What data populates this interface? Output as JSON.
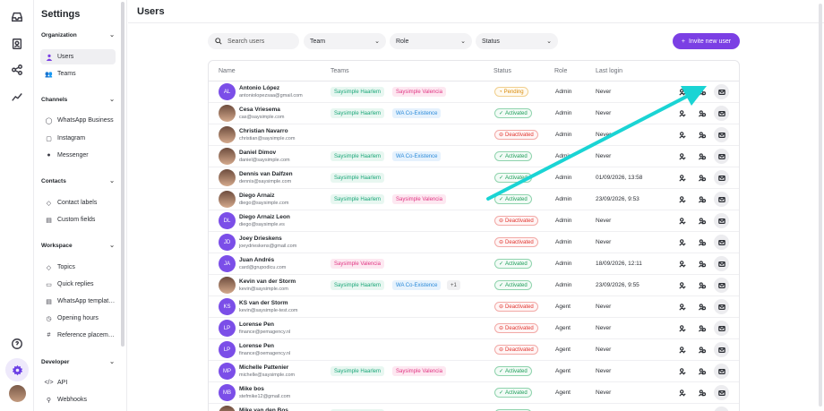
{
  "rail": {
    "icons": [
      "inbox-icon",
      "contacts-icon",
      "flows-icon",
      "reports-icon",
      "help-icon",
      "settings-icon",
      "avatar"
    ]
  },
  "sidebar": {
    "title": "Settings",
    "sections": [
      {
        "label": "Organization",
        "items": [
          {
            "label": "Users",
            "icon": "user-icon",
            "active": true
          },
          {
            "label": "Teams",
            "icon": "teams-icon"
          }
        ]
      },
      {
        "label": "Channels",
        "items": [
          {
            "label": "WhatsApp Business",
            "icon": "whatsapp-icon"
          },
          {
            "label": "Instagram",
            "icon": "instagram-icon"
          },
          {
            "label": "Messenger",
            "icon": "messenger-icon"
          }
        ]
      },
      {
        "label": "Contacts",
        "items": [
          {
            "label": "Contact labels",
            "icon": "label-icon"
          },
          {
            "label": "Custom fields",
            "icon": "fields-icon"
          }
        ]
      },
      {
        "label": "Workspace",
        "items": [
          {
            "label": "Topics",
            "icon": "tag-icon"
          },
          {
            "label": "Quick replies",
            "icon": "quick-reply-icon"
          },
          {
            "label": "WhatsApp templat…",
            "icon": "template-icon"
          },
          {
            "label": "Opening hours",
            "icon": "clock-icon"
          },
          {
            "label": "Reference placem…",
            "icon": "hash-icon"
          }
        ]
      },
      {
        "label": "Developer",
        "items": [
          {
            "label": "API",
            "icon": "code-icon"
          },
          {
            "label": "Webhooks",
            "icon": "webhook-icon"
          }
        ]
      }
    ]
  },
  "page": {
    "title": "Users"
  },
  "filters": {
    "search_placeholder": "Search users",
    "team": "Team",
    "role": "Role",
    "status": "Status",
    "invite_label": "Invite new user"
  },
  "table": {
    "headers": {
      "name": "Name",
      "teams": "Teams",
      "status": "Status",
      "role": "Role",
      "last_login": "Last login"
    },
    "rows": [
      {
        "initials": "AL",
        "name": "Antonio López",
        "email": "antoniolopezsaa@gmail.com",
        "teams": [
          "Saysimple Haarlem",
          "Saysimple Valencia"
        ],
        "status": "Pending",
        "role": "Admin",
        "last_login": "Never"
      },
      {
        "initials": "",
        "name": "Cesa Vriesema",
        "email": "cas@saysimple.com",
        "teams": [
          "Saysimple Haarlem",
          "WA Co-Existence"
        ],
        "status": "Activated",
        "role": "Admin",
        "last_login": "Never"
      },
      {
        "initials": "",
        "name": "Christian Navarro",
        "email": "christian@saysimple.com",
        "teams": [],
        "status": "Deactivated",
        "role": "Admin",
        "last_login": "Never"
      },
      {
        "initials": "",
        "name": "Daniel Dimov",
        "email": "daniel@saysimple.com",
        "teams": [
          "Saysimple Haarlem",
          "WA Co-Existence"
        ],
        "status": "Activated",
        "role": "Admin",
        "last_login": "Never"
      },
      {
        "initials": "",
        "name": "Dennis van Dalfzen",
        "email": "dennis@saysimple.com",
        "teams": [
          "Saysimple Haarlem"
        ],
        "status": "Activated",
        "role": "Admin",
        "last_login": "01/09/2026, 13:58"
      },
      {
        "initials": "",
        "name": "Diego Arnaiz",
        "email": "diego@saysimple.com",
        "teams": [
          "Saysimple Haarlem",
          "Saysimple Valencia"
        ],
        "status": "Activated",
        "role": "Admin",
        "last_login": "23/09/2026, 9:53"
      },
      {
        "initials": "DL",
        "name": "Diego Arnaiz Leon",
        "email": "diego@saysimple.es",
        "teams": [],
        "status": "Deactivated",
        "role": "Admin",
        "last_login": "Never"
      },
      {
        "initials": "JD",
        "name": "Joey Drieskens",
        "email": "joeydrieskens@gmail.com",
        "teams": [],
        "status": "Deactivated",
        "role": "Admin",
        "last_login": "Never"
      },
      {
        "initials": "JA",
        "name": "Juan Andrés",
        "email": "card@grupodicu.com",
        "teams": [
          "Saysimple Valencia"
        ],
        "status": "Activated",
        "role": "Admin",
        "last_login": "18/09/2026, 12:11"
      },
      {
        "initials": "",
        "name": "Kevin van der Storm",
        "email": "kevin@saysimple.com",
        "teams": [
          "Saysimple Haarlem",
          "WA Co-Existence"
        ],
        "more": "+1",
        "status": "Activated",
        "role": "Admin",
        "last_login": "23/09/2026, 9:55"
      },
      {
        "initials": "KS",
        "name": "KS van der Storm",
        "email": "kevin@saysimple-test.com",
        "teams": [],
        "status": "Deactivated",
        "role": "Agent",
        "last_login": "Never"
      },
      {
        "initials": "LP",
        "name": "Lorense Pen",
        "email": "finance@pemagency.nl",
        "teams": [],
        "status": "Deactivated",
        "role": "Agent",
        "last_login": "Never"
      },
      {
        "initials": "LP",
        "name": "Lorense Pen",
        "email": "finance@oemagency.nl",
        "teams": [],
        "status": "Deactivated",
        "role": "Agent",
        "last_login": "Never"
      },
      {
        "initials": "MP",
        "name": "Michelle Pattenier",
        "email": "michelle@saysimple.com",
        "teams": [
          "Saysimple Haarlem",
          "Saysimple Valencia"
        ],
        "status": "Activated",
        "role": "Agent",
        "last_login": "Never"
      },
      {
        "initials": "MB",
        "name": "Mike bos",
        "email": "stefmike12@gmail.com",
        "teams": [],
        "status": "Activated",
        "role": "Agent",
        "last_login": "Never"
      },
      {
        "initials": "",
        "name": "Mike van den Bos",
        "email": "",
        "teams": [
          "Saysimple Haarlem"
        ],
        "status": "Activated",
        "role": "",
        "last_login": ""
      }
    ]
  },
  "colors": {
    "accent": "#7b3fe4",
    "annotation_arrow": "#1ad4d4"
  }
}
